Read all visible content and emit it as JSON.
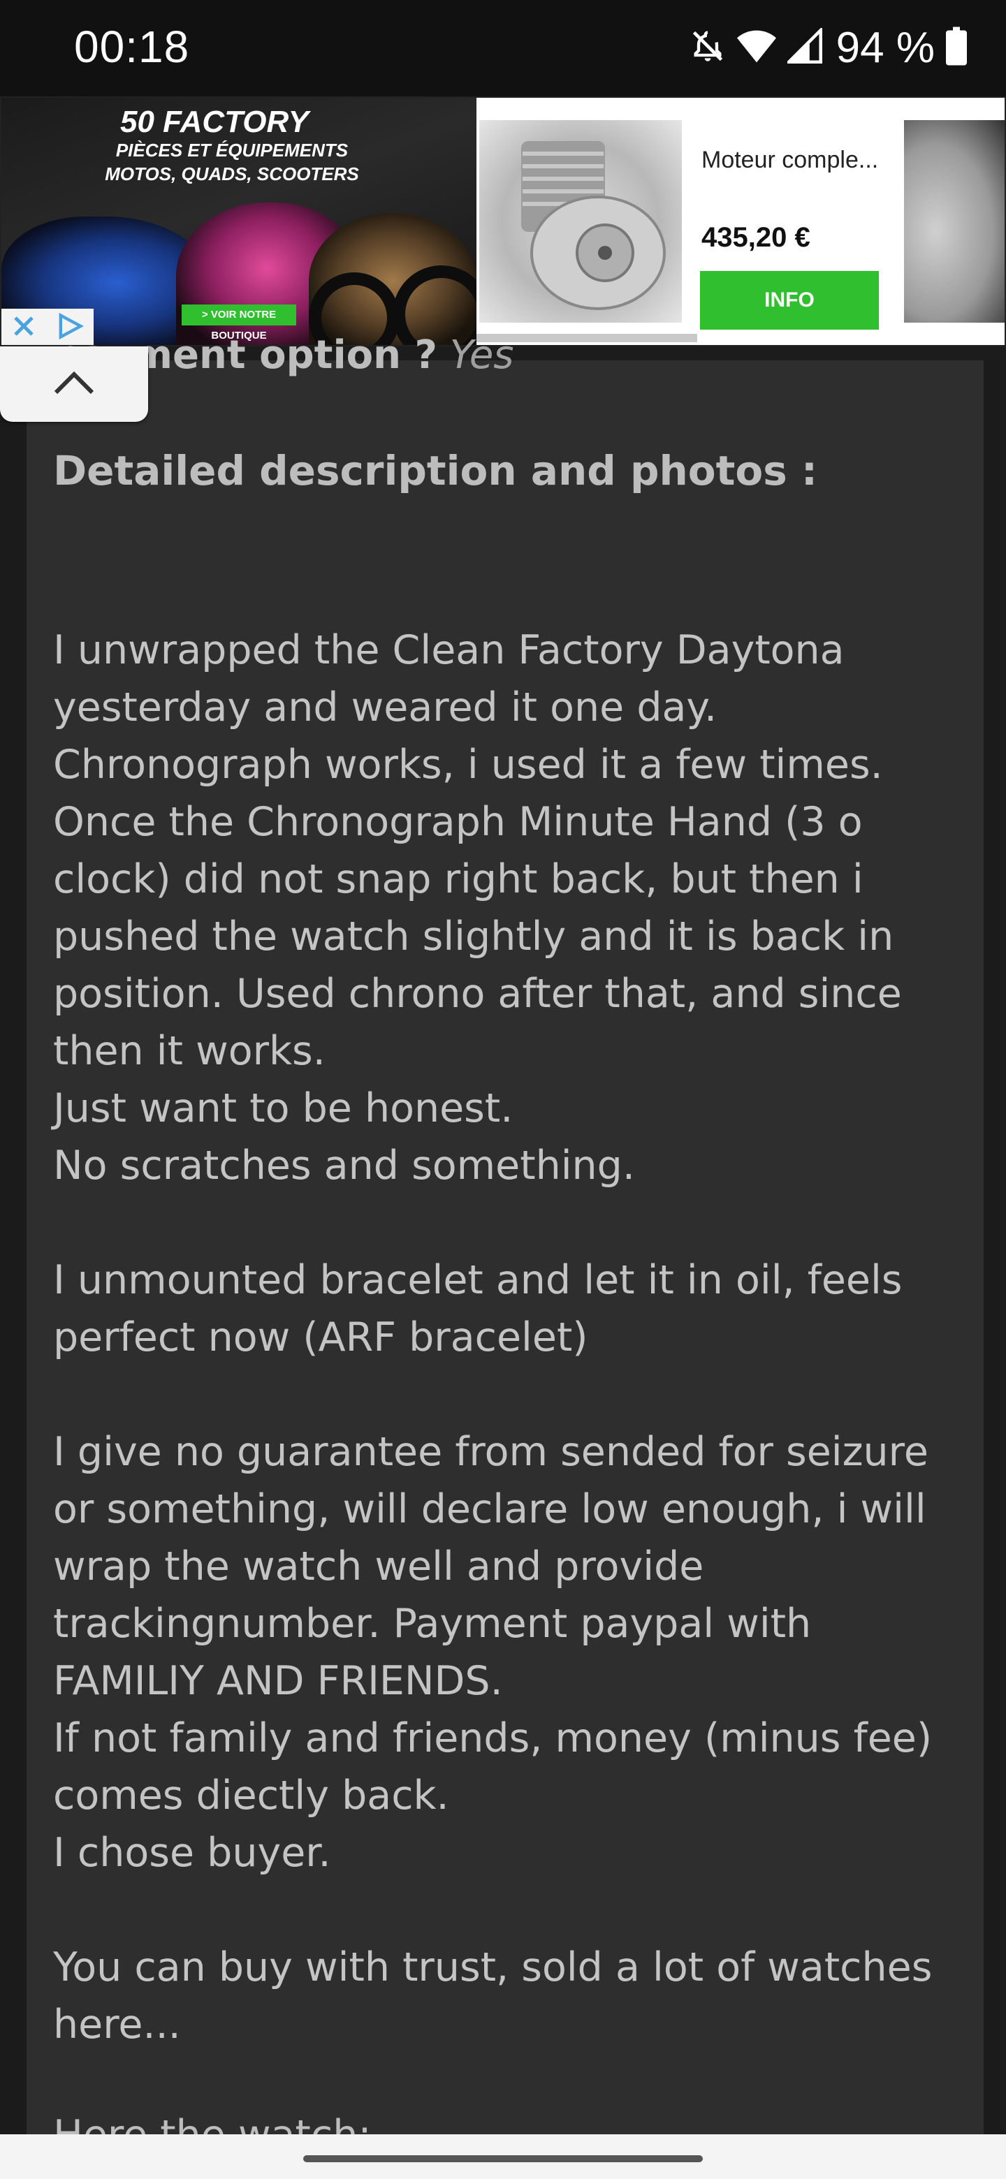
{
  "status_bar": {
    "time": "00:18",
    "battery_percent": "94 %",
    "icons": [
      "mute-icon",
      "wifi-icon",
      "signal-icon",
      "battery-icon"
    ]
  },
  "ad": {
    "brand_logo": "50 FACTORY",
    "brand_tagline": "PIÈCES ET ÉQUIPEMENTS MOTOS, QUADS, SCOOTERS",
    "shop_button": "> VOIR NOTRE BOUTIQUE",
    "product_title": "Moteur comple...",
    "product_price": "435,20 €",
    "info_button": "INFO",
    "icons": [
      "ad-close-icon",
      "adchoices-icon"
    ]
  },
  "listing": {
    "partial_field_label": "payment option ?",
    "partial_field_value": "Yes",
    "section_heading": "Detailed description and photos :",
    "description": "I unwrapped the Clean Factory Daytona\nyesterday and weared it one day.\nChronograph works, i used it a few times.\nOnce the Chronograph Minute Hand (3 o\nclock) did not snap right back, but then i\npushed the watch slightly and it is back in\nposition. Used chrono after that, and since\nthen it works.\nJust want to be honest.\nNo scratches and something.\n\nI unmounted bracelet and let it in oil, feels\nperfect now (ARF bracelet)\n\nI give no guarantee from sended for seizure\nor something, will declare low enough, i will\nwrap the watch well and provide\ntrackingnumber. Payment paypal with\nFAMILIY AND FRIENDS.\nIf not family and friends, money (minus fee)\ncomes diectly back.\nI chose buyer.\n\nYou can buy with trust, sold a lot of watches\nhere...",
    "trailing_text": "Here the watch:"
  },
  "colors": {
    "panel_bg": "#2e2e2e",
    "page_bg": "#1c1c1c",
    "text": "#c4c4c4",
    "ad_accent_green": "#2fbf2f"
  }
}
